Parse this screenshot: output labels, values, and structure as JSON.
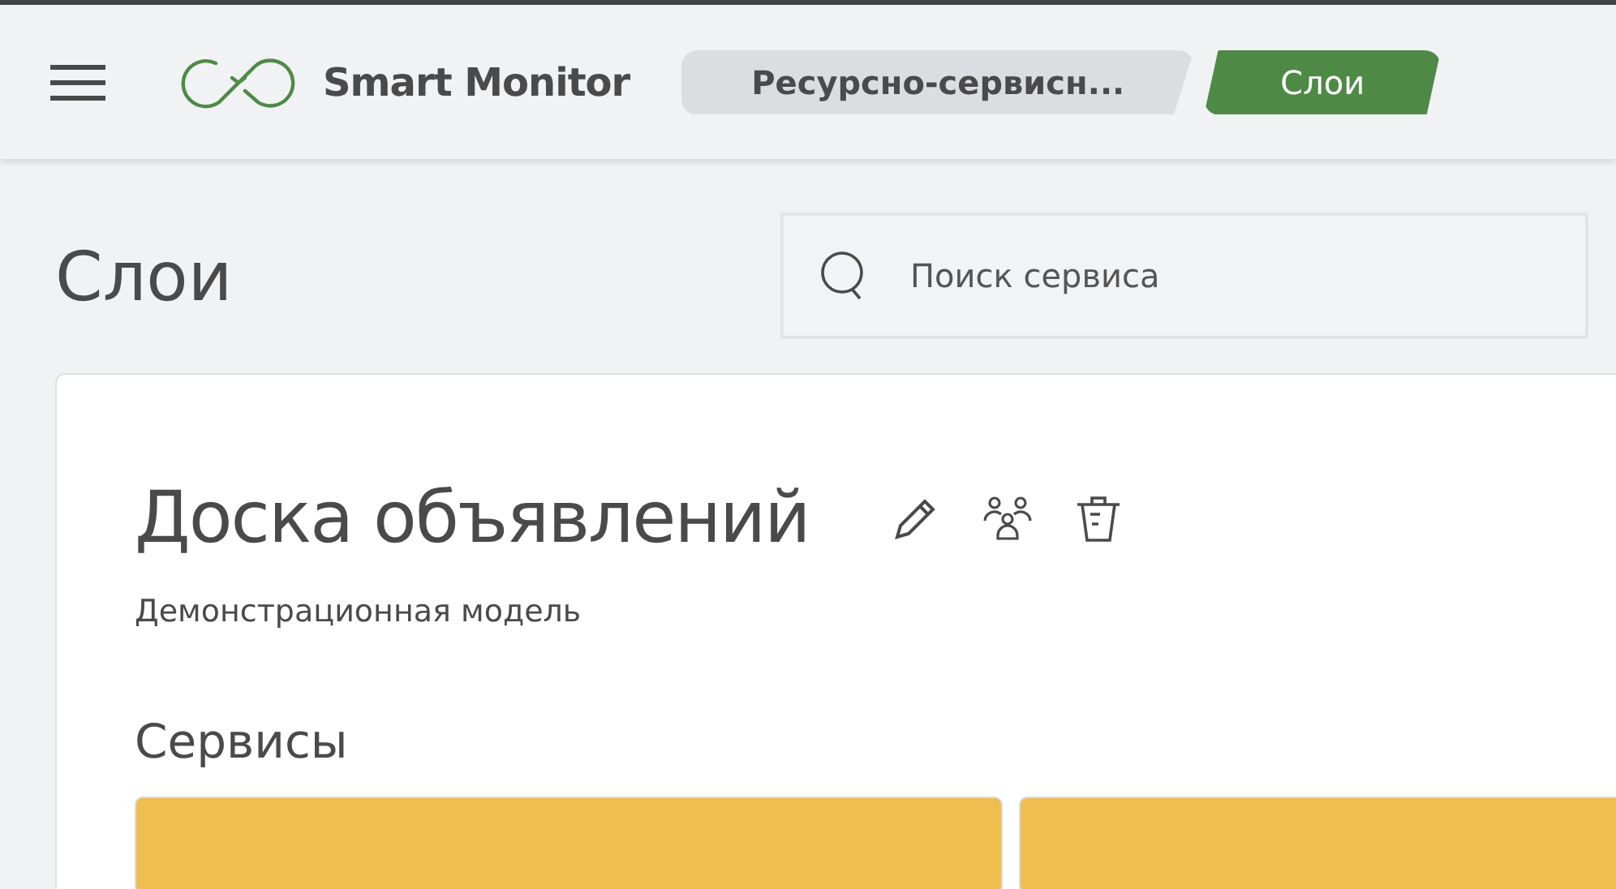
{
  "header": {
    "app_name": "Smart Monitor"
  },
  "breadcrumbs": [
    {
      "label": "Ресурсно-сервисн...",
      "selected": false
    },
    {
      "label": "Слои",
      "selected": true
    }
  ],
  "page": {
    "title": "Слои"
  },
  "search": {
    "placeholder": "Поиск сервиса"
  },
  "model": {
    "title": "Доска объявлений",
    "subtitle": "Демонстрационная модель",
    "section_title": "Сервисы"
  }
}
